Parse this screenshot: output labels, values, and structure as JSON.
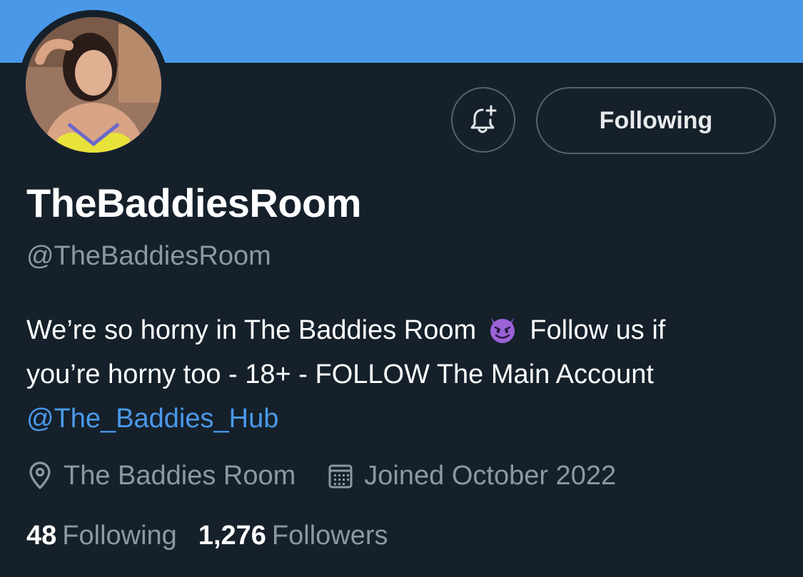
{
  "profile": {
    "display_name": "TheBaddiesRoom",
    "handle": "@TheBaddiesRoom",
    "bio": {
      "line1_before": "We’re so horny in The Baddies Room",
      "emoji": "smiling-face-with-horns",
      "line1_after": "Follow us if",
      "line2": "you’re horny too - 18+ - FOLLOW The Main Account",
      "mention": "@The_Baddies_Hub"
    },
    "location": "The Baddies Room",
    "joined": "Joined October 2022",
    "stats": {
      "following_count": "48",
      "following_label": "Following",
      "followers_count": "1,276",
      "followers_label": "Followers"
    }
  },
  "actions": {
    "notify_icon": "bell-plus-icon",
    "following_label": "Following"
  },
  "colors": {
    "background": "#15202b",
    "banner": "#4a99e9",
    "link": "#4a99e9",
    "secondary_text": "#8b98a5",
    "border": "#536471"
  }
}
